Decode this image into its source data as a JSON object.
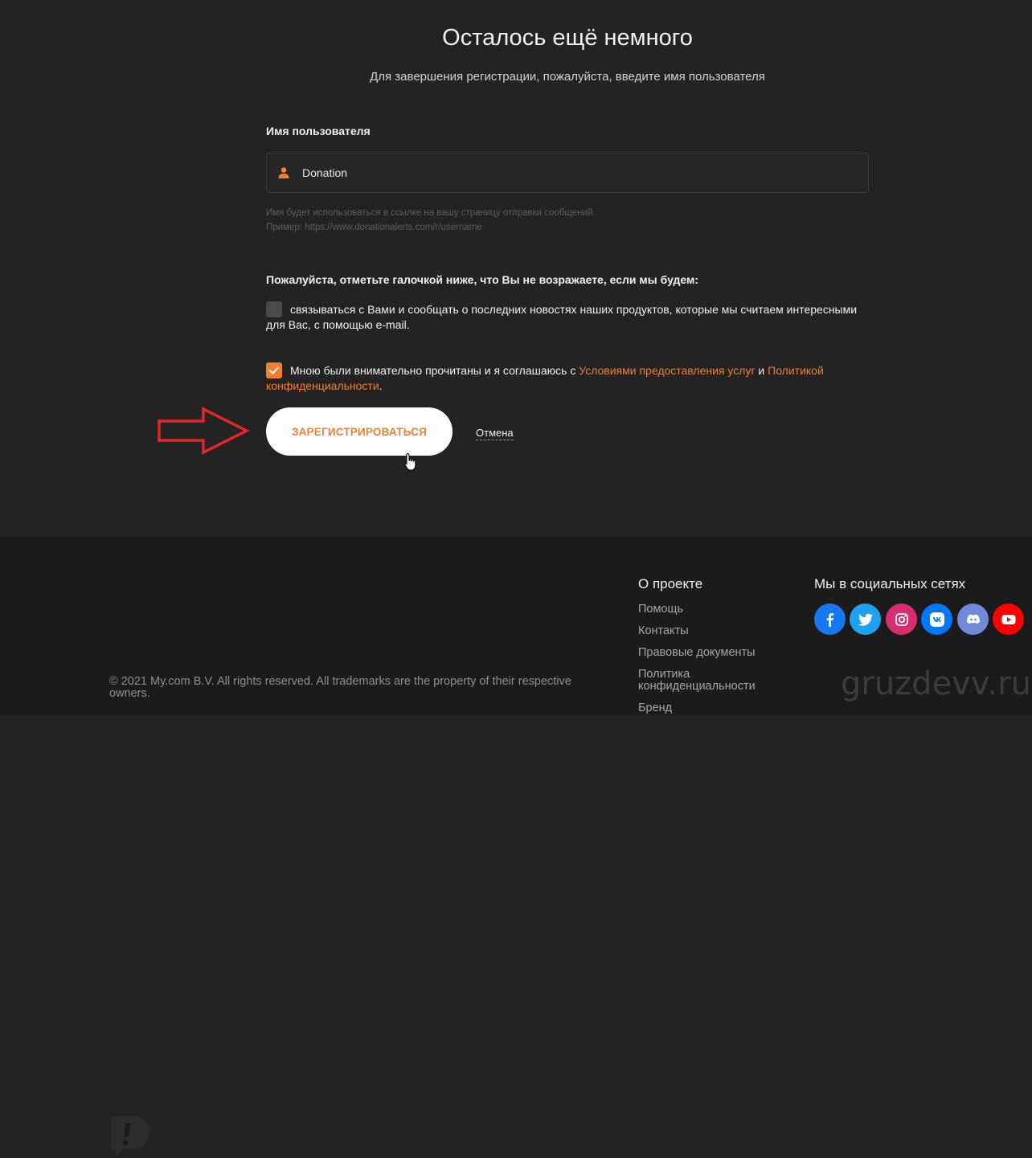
{
  "page": {
    "title": "Осталось ещё немного",
    "subtitle": "Для завершения регистрации, пожалуйста, введите имя пользователя"
  },
  "username": {
    "label": "Имя пользователя",
    "value": "Donation",
    "icon": "user-icon",
    "hint_line1": "Имя будет использоваться в ссылке на вашу страницу отправки сообщений.",
    "hint_line2": "Пример: https://www.donationalerts.com/r/username"
  },
  "consent": {
    "title": "Пожалуйста, отметьте галочкой ниже, что Вы не возражаете, если мы будем:",
    "newsletter_text": "связываться с Вами и сообщать о последних новостях наших продуктов, которые мы считаем интересными для Вас, с помощью e-mail.",
    "newsletter_checked": false,
    "terms_prefix": "Мною были внимательно прочитаны и я соглашаюсь с ",
    "terms_link": "Условиями предоставления услуг",
    "terms_and": " и ",
    "privacy_link": "Политикой конфиденциальности",
    "terms_suffix": ".",
    "terms_checked": true
  },
  "actions": {
    "register_label": "ЗАРЕГИСТРИРОВАТЬСЯ",
    "cancel_label": "Отмена"
  },
  "footer": {
    "copyright": "© 2021 My.com B.V. All rights reserved. All trademarks are the property of their respective owners.",
    "about_title": "О проекте",
    "about_links": [
      "Помощь",
      "Контакты",
      "Правовые документы",
      "Политика конфиденциальности",
      "Бренд"
    ],
    "social_title": "Мы в социальных сетях",
    "social": [
      {
        "name": "facebook-icon",
        "color": "#1877f2"
      },
      {
        "name": "twitter-icon",
        "color": "#1da1f2"
      },
      {
        "name": "instagram-icon",
        "color": "#d62e6e"
      },
      {
        "name": "vk-icon",
        "color": "#0077ff"
      },
      {
        "name": "discord-icon",
        "color": "#7289da"
      },
      {
        "name": "youtube-icon",
        "color": "#ff0000"
      }
    ]
  },
  "watermark": "gruzdevv.ru",
  "colors": {
    "accent": "#f57d2d",
    "background": "#232324",
    "footer": "#1b1b1c"
  }
}
